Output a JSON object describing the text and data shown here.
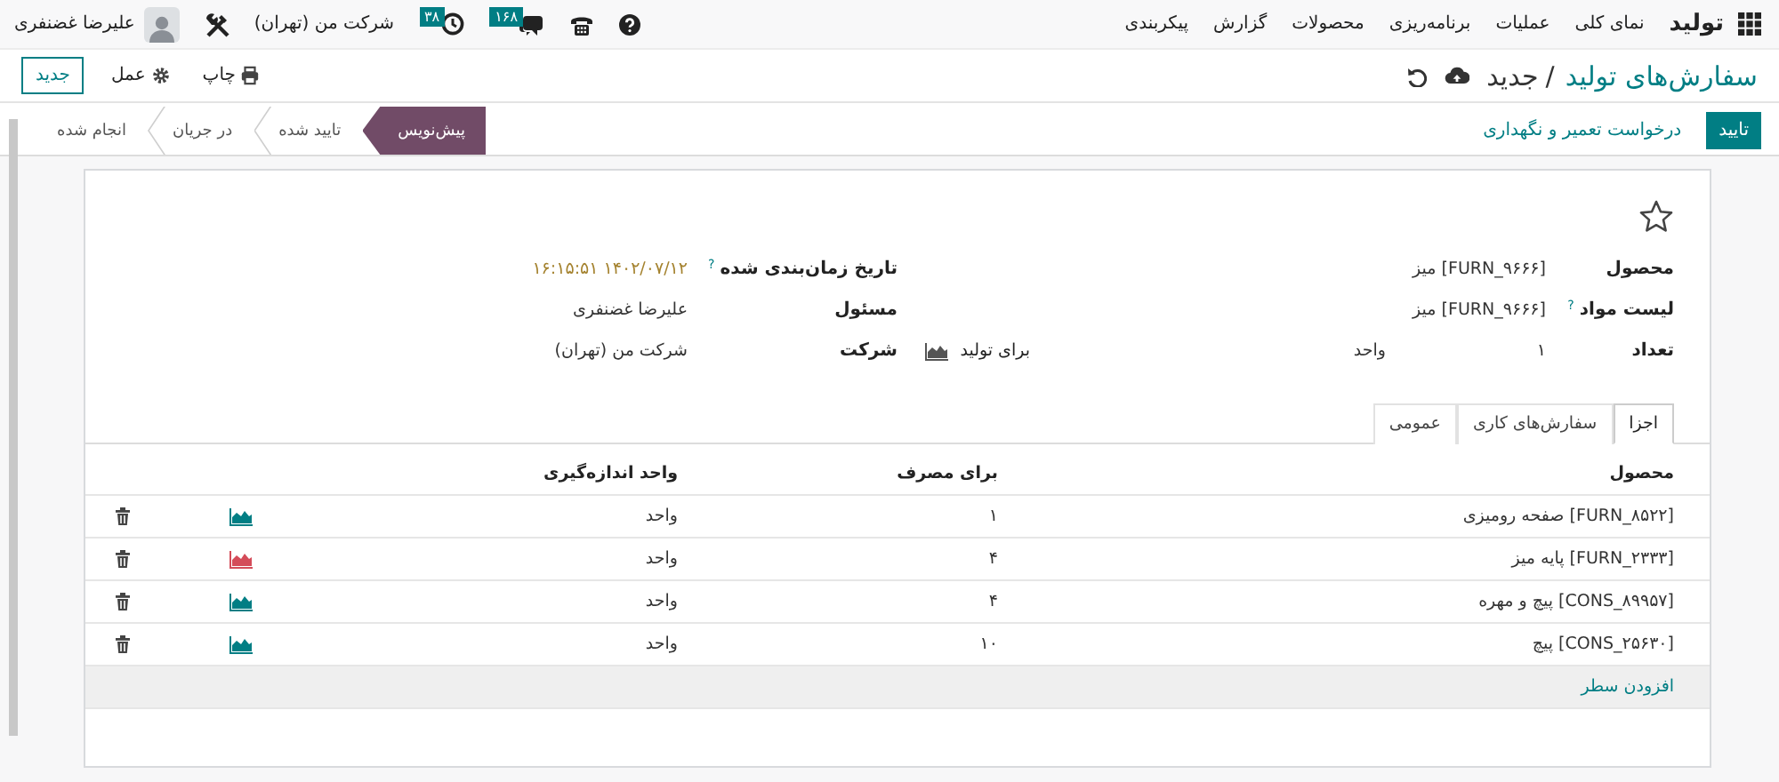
{
  "navbar": {
    "app_name": "تولید",
    "menu": [
      "نمای کلی",
      "عملیات",
      "برنامه‌ریزی",
      "محصولات",
      "گزارش",
      "پیکربندی"
    ],
    "messages_badge": "۱۶۸",
    "activities_badge": "۳۸",
    "company": "شرکت من (تهران)",
    "user_name": "علیرضا غضنفری"
  },
  "control_panel": {
    "breadcrumb_parent": "سفارش‌های تولید",
    "breadcrumb_separator": "/",
    "breadcrumb_current": "جدید",
    "actions": [
      {
        "kind": "print",
        "label": "چاپ"
      },
      {
        "kind": "action",
        "label": "عمل"
      }
    ],
    "new_button": "جدید"
  },
  "status_bar": {
    "confirm_button": "تایید",
    "maintenance_link": "درخواست تعمیر و نگهداری",
    "stages": [
      {
        "label": "پیش‌نویس",
        "selected": true
      },
      {
        "label": "تایید شده",
        "selected": false
      },
      {
        "label": "در جریان",
        "selected": false
      },
      {
        "label": "انجام شده",
        "selected": false
      }
    ]
  },
  "form": {
    "starred": false,
    "fields_right": [
      {
        "kind": "text",
        "label": "محصول",
        "value": "[FURN_۹۶۶۶] میز"
      },
      {
        "kind": "text",
        "label": "لیست مواد",
        "help": "?",
        "value": "[FURN_۹۶۶۶] میز"
      },
      {
        "kind": "quantity",
        "label": "تعداد",
        "value": "۱",
        "unit": "واحد",
        "link": "برای تولید"
      }
    ],
    "fields_left": [
      {
        "kind": "date",
        "label": "تاریخ زمان‌بندی شده",
        "help": "?",
        "value": "۱۴۰۲/۰۷/۱۲ ۱۶:۱۵:۵۱"
      },
      {
        "kind": "text",
        "label": "مسئول",
        "value": "علیرضا غضنفری"
      },
      {
        "kind": "text",
        "label": "شرکت",
        "value": "شرکت من (تهران)"
      }
    ]
  },
  "tabs": [
    {
      "label": "اجزا",
      "selected": true
    },
    {
      "label": "سفارش‌های کاری",
      "selected": false
    },
    {
      "label": "عمومی",
      "selected": false
    }
  ],
  "components": {
    "columns": [
      "محصول",
      "برای مصرف",
      "واحد اندازه‌گیری"
    ],
    "rows": [
      {
        "product": "[FURN_۸۵۲۲] صفحه رومیزی",
        "quantity": "۱",
        "uom": "واحد",
        "color": "#017e84"
      },
      {
        "product": "[FURN_۲۳۳۳] پایه میز",
        "quantity": "۴",
        "uom": "واحد",
        "color": "#d44c59"
      },
      {
        "product": "[CONS_۸۹۹۵۷] پیچ و مهره",
        "quantity": "۴",
        "uom": "واحد",
        "color": "#017e84"
      },
      {
        "product": "[CONS_۲۵۶۳۰] پیچ",
        "quantity": "۱۰",
        "uom": "واحد",
        "color": "#017e84"
      }
    ],
    "add_line": "افزودن سطر"
  }
}
